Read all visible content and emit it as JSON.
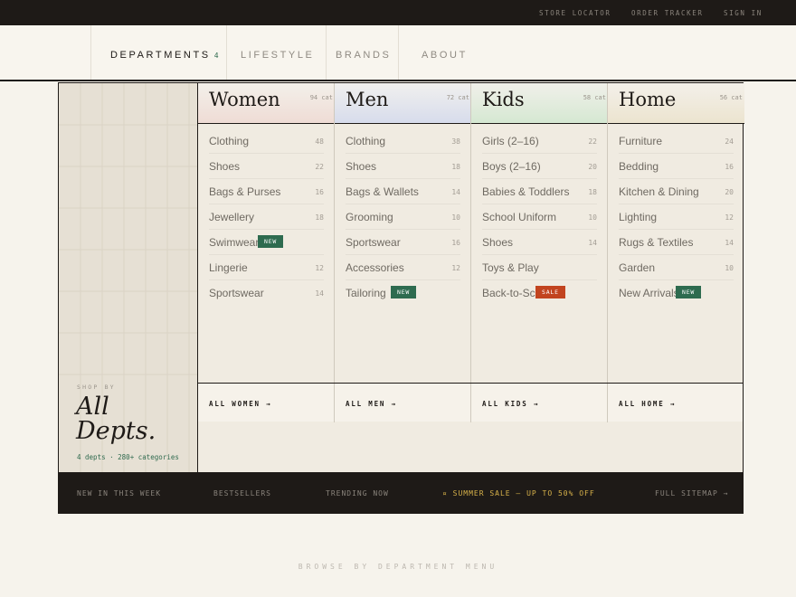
{
  "topbar": {
    "links": [
      "STORE LOCATOR",
      "ORDER TRACKER",
      "SIGN IN"
    ]
  },
  "nav": {
    "items": [
      {
        "label": "DEPARTMENTS",
        "count": "4"
      },
      {
        "label": "LIFESTYLE"
      },
      {
        "label": "BRANDS"
      },
      {
        "label": "ABOUT"
      }
    ]
  },
  "hero": {
    "kicker": "SHOP BY",
    "title_line1": "All",
    "title_line2": "Depts.",
    "meta": "4 depts · 280+ categories"
  },
  "colors": {
    "women": "#efdcd5",
    "men": "#d7dcec",
    "kids": "#d5e8d2",
    "home": "#ece4cf",
    "badge_new": "#2e6b4f",
    "badge_sale": "#c2441f",
    "sale_text": "#d8b24a"
  },
  "departments": [
    {
      "name": "Women",
      "count": "94 cat",
      "all": "ALL WOMEN →",
      "items": [
        {
          "label": "Clothing",
          "num": "48"
        },
        {
          "label": "Shoes",
          "num": "22"
        },
        {
          "label": "Bags & Purses",
          "num": "16"
        },
        {
          "label": "Jewellery",
          "num": "18"
        },
        {
          "label": "Swimwear",
          "badge": "NEW"
        },
        {
          "label": "Lingerie",
          "num": "12"
        },
        {
          "label": "Sportswear",
          "num": "14"
        }
      ]
    },
    {
      "name": "Men",
      "count": "72 cat",
      "all": "ALL MEN →",
      "items": [
        {
          "label": "Clothing",
          "num": "38"
        },
        {
          "label": "Shoes",
          "num": "18"
        },
        {
          "label": "Bags & Wallets",
          "num": "14"
        },
        {
          "label": "Grooming",
          "num": "10"
        },
        {
          "label": "Sportswear",
          "num": "16"
        },
        {
          "label": "Accessories",
          "num": "12"
        },
        {
          "label": "Tailoring",
          "badge": "NEW"
        }
      ]
    },
    {
      "name": "Kids",
      "count": "58 cat",
      "all": "ALL KIDS →",
      "items": [
        {
          "label": "Girls (2–16)",
          "num": "22"
        },
        {
          "label": "Boys (2–16)",
          "num": "20"
        },
        {
          "label": "Babies & Toddlers",
          "num": "18"
        },
        {
          "label": "School Uniform",
          "num": "10"
        },
        {
          "label": "Shoes",
          "num": "14"
        },
        {
          "label": "Toys & Play"
        },
        {
          "label": "Back-to-School",
          "badge": "SALE"
        }
      ]
    },
    {
      "name": "Home",
      "count": "56 cat",
      "all": "ALL HOME →",
      "items": [
        {
          "label": "Furniture",
          "num": "24"
        },
        {
          "label": "Bedding",
          "num": "16"
        },
        {
          "label": "Kitchen & Dining",
          "num": "20"
        },
        {
          "label": "Lighting",
          "num": "12"
        },
        {
          "label": "Rugs & Textiles",
          "num": "14"
        },
        {
          "label": "Garden",
          "num": "10"
        },
        {
          "label": "New Arrivals",
          "badge": "NEW"
        }
      ]
    }
  ],
  "bottombar": {
    "links": [
      "NEW IN THIS WEEK",
      "BESTSELLERS",
      "TRENDING NOW",
      "¤ SUMMER SALE — UP TO 50% OFF",
      "FULL SITEMAP →"
    ]
  },
  "caption": "BROWSE BY DEPARTMENT MENU"
}
